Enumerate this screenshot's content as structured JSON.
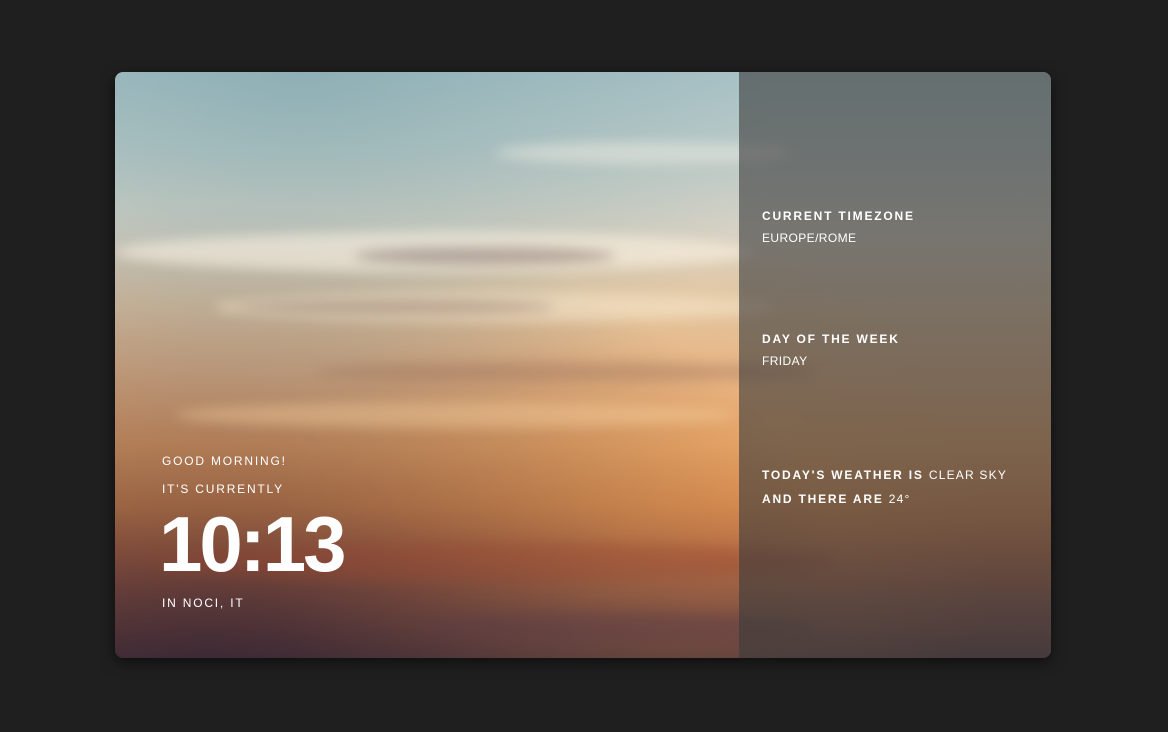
{
  "main": {
    "greeting": "GOOD MORNING!",
    "currently": "IT'S CURRENTLY",
    "time": "10:13",
    "location": "IN NOCI, IT"
  },
  "info": {
    "timezone_label": "CURRENT TIMEZONE",
    "timezone_value": "EUROPE/ROME",
    "day_label": "DAY OF THE WEEK",
    "day_value": "FRIDAY",
    "weather_prefix": "TODAY'S WEATHER IS",
    "weather_value": "CLEAR SKY",
    "temp_prefix": "AND THERE ARE",
    "temp_value": "24°"
  }
}
